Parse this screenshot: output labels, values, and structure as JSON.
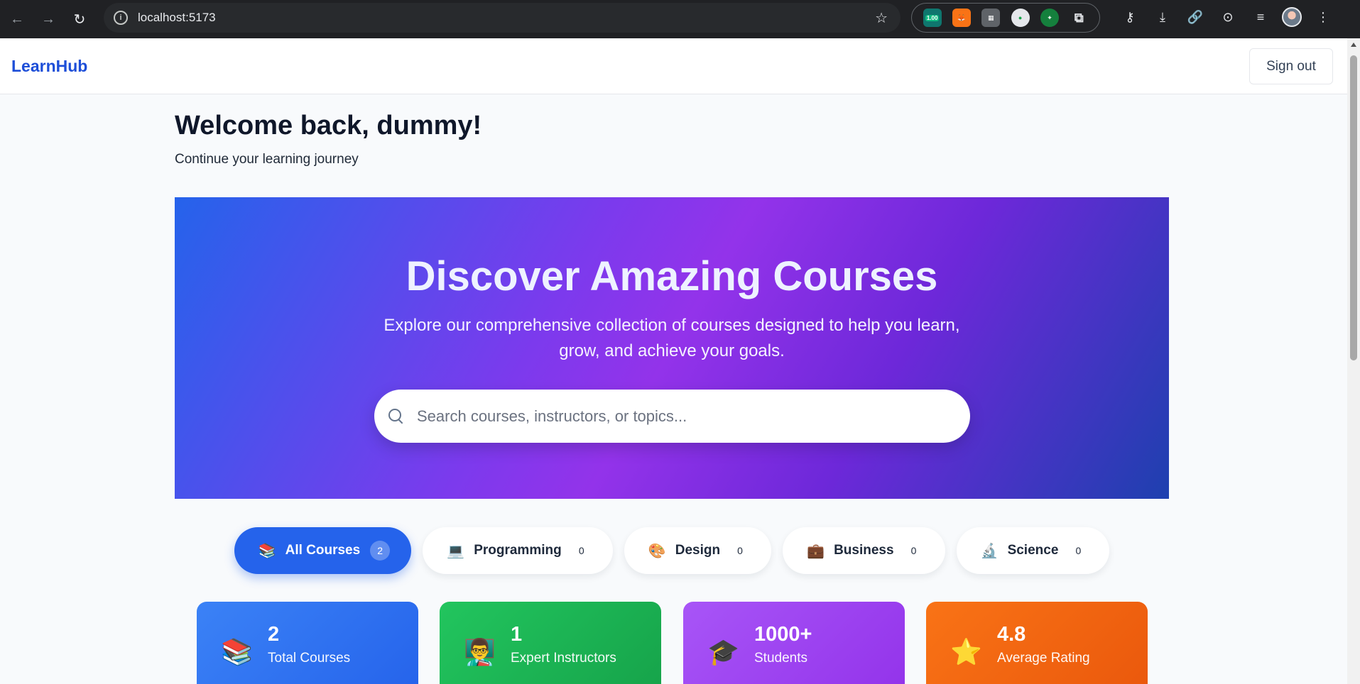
{
  "browser": {
    "url": "localhost:5173",
    "extension_badge": "1.00"
  },
  "app": {
    "brand": "LearnHub",
    "signout_label": "Sign out"
  },
  "welcome": {
    "title": "Welcome back, dummy!",
    "subtitle": "Continue your learning journey"
  },
  "hero": {
    "title": "Discover Amazing Courses",
    "subtitle": "Explore our comprehensive collection of courses designed to help you learn, grow, and achieve your goals.",
    "search_placeholder": "Search courses, instructors, or topics..."
  },
  "categories": [
    {
      "label": "All Courses",
      "count": "2",
      "icon": "books-icon",
      "active": true
    },
    {
      "label": "Programming",
      "count": "0",
      "icon": "computer-icon",
      "active": false
    },
    {
      "label": "Design",
      "count": "0",
      "icon": "palette-icon",
      "active": false
    },
    {
      "label": "Business",
      "count": "0",
      "icon": "briefcase-icon",
      "active": false
    },
    {
      "label": "Science",
      "count": "0",
      "icon": "microscope-icon",
      "active": false
    }
  ],
  "stats": [
    {
      "value": "2",
      "label": "Total Courses",
      "icon": "books-icon",
      "color": "#3b82f6"
    },
    {
      "value": "1",
      "label": "Expert Instructors",
      "icon": "teacher-icon",
      "color": "#22c55e"
    },
    {
      "value": "1000+",
      "label": "Students",
      "icon": "graduation-cap-icon",
      "color": "#a855f7"
    },
    {
      "value": "4.8",
      "label": "Average Rating",
      "icon": "star-icon",
      "color": "#f97316"
    }
  ],
  "colors": {
    "brand": "#1d4ed8",
    "accent": "#2563eb",
    "hero_gradient": [
      "#2563eb",
      "#9333ea",
      "#1e40af"
    ]
  }
}
